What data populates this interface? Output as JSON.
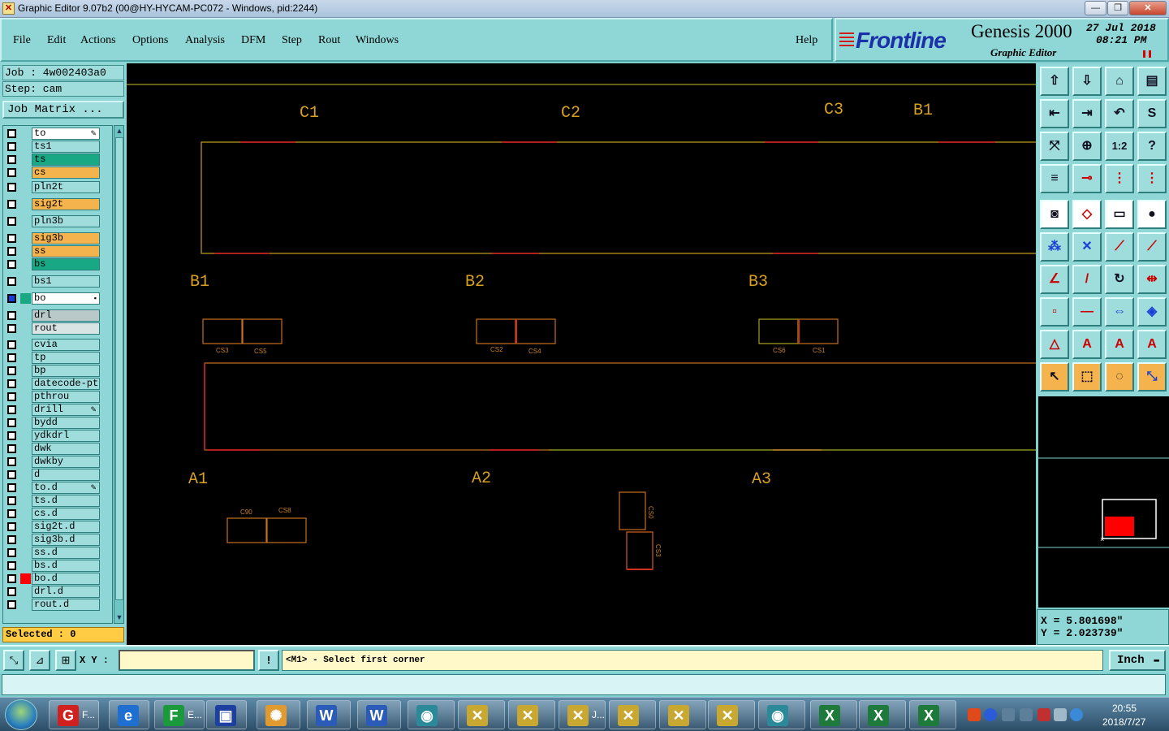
{
  "window": {
    "title": "Graphic Editor 9.07b2 (00@HY-HYCAM-PC072 - Windows, pid:2244)",
    "icon_glyph": "✕",
    "minimize": "—",
    "maximize": "❐",
    "close": "✕"
  },
  "menu": {
    "items": [
      "File",
      "Edit",
      "Actions",
      "Options",
      "Analysis",
      "DFM",
      "Step",
      "Rout",
      "Windows"
    ],
    "help": "Help"
  },
  "brand": {
    "logo": "Frontline",
    "product": "Genesis 2000",
    "subtitle": "Graphic Editor",
    "date": "27 Jul 2018",
    "time": "08:21 PM"
  },
  "job": {
    "job_line": "Job : 4w002403a0",
    "step_line": "Step: cam",
    "matrix_button": "Job Matrix ..."
  },
  "layers": [
    {
      "name": "to",
      "color": "#ffffff",
      "mark": "✎"
    },
    {
      "name": "ts1",
      "color": "#9fdcdc"
    },
    {
      "name": "ts",
      "color": "#18a884"
    },
    {
      "name": "cs",
      "color": "#f5b34d"
    },
    {
      "name": "pln2t",
      "color": "#9fdcdc"
    },
    {
      "name": "sig2t",
      "color": "#f5b34d"
    },
    {
      "name": "pln3b",
      "color": "#9fdcdc"
    },
    {
      "name": "sig3b",
      "color": "#f5b34d"
    },
    {
      "name": "ss",
      "color": "#f5b34d"
    },
    {
      "name": "bs",
      "color": "#18a884"
    },
    {
      "name": "bs1",
      "color": "#9fdcdc"
    },
    {
      "name": "bo",
      "color": "#ffffff",
      "active": true,
      "mark": "▪"
    },
    {
      "name": "drl",
      "color": "#b9c9c9"
    },
    {
      "name": "rout",
      "color": "#d8e4e4"
    },
    {
      "name": "cvia",
      "color": "#9fdcdc"
    },
    {
      "name": "tp",
      "color": "#9fdcdc"
    },
    {
      "name": "bp",
      "color": "#9fdcdc"
    },
    {
      "name": "datecode-ptc",
      "color": "#9fdcdc"
    },
    {
      "name": "pthrou",
      "color": "#9fdcdc"
    },
    {
      "name": "drill",
      "color": "#9fdcdc",
      "mark": "✎"
    },
    {
      "name": "bydd",
      "color": "#9fdcdc"
    },
    {
      "name": "ydkdrl",
      "color": "#9fdcdc"
    },
    {
      "name": "dwk",
      "color": "#9fdcdc"
    },
    {
      "name": "dwkby",
      "color": "#9fdcdc"
    },
    {
      "name": "d",
      "color": "#9fdcdc"
    },
    {
      "name": "to.d",
      "color": "#9fdcdc",
      "mark": "✎"
    },
    {
      "name": "ts.d",
      "color": "#9fdcdc"
    },
    {
      "name": "cs.d",
      "color": "#9fdcdc"
    },
    {
      "name": "sig2t.d",
      "color": "#9fdcdc"
    },
    {
      "name": "sig3b.d",
      "color": "#9fdcdc"
    },
    {
      "name": "ss.d",
      "color": "#9fdcdc"
    },
    {
      "name": "bs.d",
      "color": "#9fdcdc"
    },
    {
      "name": "bo.d",
      "color": "#9fdcdc",
      "swatch": "#ff0000"
    },
    {
      "name": "drl.d",
      "color": "#9fdcdc"
    },
    {
      "name": "rout.d",
      "color": "#9fdcdc"
    }
  ],
  "selected_text": "Selected : 0",
  "canvas": {
    "labels": [
      "C1",
      "C2",
      "C3",
      "B1",
      "B1",
      "B2",
      "B3",
      "A1",
      "A2",
      "A3"
    ],
    "component_labels": [
      "CS3",
      "CS5",
      "CS2",
      "CS4",
      "CS6",
      "CS1",
      "C90",
      "CS8",
      "CS0",
      "CS3"
    ]
  },
  "coords": {
    "x": "X = 5.801698\"",
    "y": "Y = 2.023739\""
  },
  "prompt": {
    "xy_label": "X Y :",
    "xy_value": "",
    "info_icon": "!",
    "text": "<M1> - Select first corner",
    "units": "Inch"
  },
  "taskbar": {
    "items": [
      {
        "label": "F...",
        "icon": "G",
        "color": "#d02020"
      },
      {
        "label": "",
        "icon": "e",
        "color": "#1f6fd0"
      },
      {
        "label": "E...",
        "icon": "F",
        "color": "#1a9a3a"
      },
      {
        "label": "",
        "icon": "▣",
        "color": "#1c3fa0"
      },
      {
        "label": "",
        "icon": "✺",
        "color": "#e09a30"
      },
      {
        "label": "",
        "icon": "W",
        "color": "#2a5bb8"
      },
      {
        "label": "",
        "icon": "W",
        "color": "#2a5bb8"
      },
      {
        "label": "",
        "icon": "◉",
        "color": "#2a8a9a"
      },
      {
        "label": "",
        "icon": "✕",
        "color": "#c8a830"
      },
      {
        "label": "",
        "icon": "✕",
        "color": "#c8a830"
      },
      {
        "label": "J...",
        "icon": "✕",
        "color": "#c8a830"
      },
      {
        "label": "",
        "icon": "✕",
        "color": "#c8a830"
      },
      {
        "label": "",
        "icon": "✕",
        "color": "#c8a830"
      },
      {
        "label": "",
        "icon": "✕",
        "color": "#c8a830"
      },
      {
        "label": "",
        "icon": "◉",
        "color": "#2a8a9a"
      },
      {
        "label": "",
        "icon": "X",
        "color": "#1e7a3a"
      },
      {
        "label": "",
        "icon": "X",
        "color": "#1e7a3a"
      },
      {
        "label": "",
        "icon": "X",
        "color": "#1e7a3a"
      }
    ],
    "clock_time": "20:55",
    "clock_date": "2018/7/27"
  }
}
